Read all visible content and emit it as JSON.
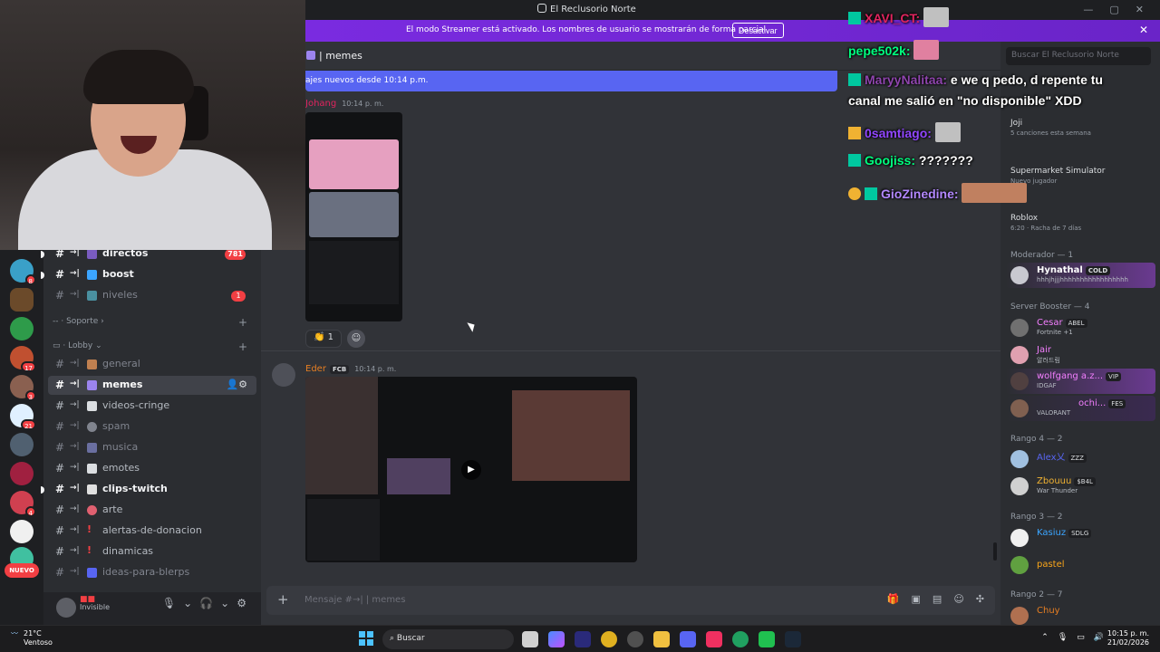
{
  "window": {
    "title": "El Reclusorio Norte",
    "controls": [
      "—",
      "▢",
      "✕"
    ]
  },
  "banner": {
    "text": "El modo Streamer está activado. Los nombres de usuario se mostrarán de forma parcial.",
    "button": "Desactivar"
  },
  "servers": {
    "badges": [
      "8",
      "",
      "",
      "17",
      "3",
      "21",
      "",
      "",
      "4"
    ],
    "new_label": "NUEVO"
  },
  "channels": {
    "items": [
      {
        "name": "directos",
        "arrows": "→|",
        "bold": true,
        "badge": "781"
      },
      {
        "name": "boost",
        "arrows": "→|",
        "bold": true,
        "badge": ""
      },
      {
        "name": "niveles",
        "arrows": "→|",
        "bold": false,
        "badge": "1"
      },
      {
        "name": "general",
        "arrows": "→|",
        "bold": false,
        "badge": ""
      },
      {
        "name": "memes",
        "arrows": "→|",
        "bold": true,
        "badge": ""
      },
      {
        "name": "videos-cringe",
        "arrows": "→|",
        "bold": false,
        "badge": ""
      },
      {
        "name": "spam",
        "arrows": "→|",
        "bold": false,
        "badge": ""
      },
      {
        "name": "musica",
        "arrows": "→|",
        "bold": false,
        "badge": ""
      },
      {
        "name": "emotes",
        "arrows": "→|",
        "bold": false,
        "badge": ""
      },
      {
        "name": "clips-twitch",
        "arrows": "→|",
        "bold": true,
        "badge": ""
      },
      {
        "name": "arte",
        "arrows": "→|",
        "bold": false,
        "badge": ""
      },
      {
        "name": "alertas-de-donacion",
        "arrows": "→|",
        "bold": false,
        "badge": ""
      },
      {
        "name": "dinamicas",
        "arrows": "→|",
        "bold": false,
        "badge": ""
      },
      {
        "name": "ideas-para-blerps",
        "arrows": "→|",
        "bold": false,
        "badge": ""
      }
    ],
    "category_support": "Soporte",
    "category_lobby": "Lobby"
  },
  "user": {
    "status": "Invisible"
  },
  "chat": {
    "channel_name": "memes",
    "new_messages": "ajes nuevos desde 10:14 p.m.",
    "msg1_author": "Johang",
    "msg1_time": "10:14 p. m.",
    "reaction_count": "1",
    "msg2_author": "Eder",
    "msg2_tag": "FCB",
    "msg2_time": "10:14 p. m.",
    "input_placeholder": "Mensaje #→|  | memes"
  },
  "members": {
    "search_placeholder": "Buscar El Reclusorio Norte",
    "activities": [
      {
        "title": "Joji",
        "sub": "5 canciones esta semana"
      },
      {
        "title": "Supermarket Simulator",
        "sub": "Nuevo jugador"
      },
      {
        "title": "Roblox",
        "sub": "6:20 · Racha de 7 días"
      }
    ],
    "group_mod": "Moderador — 1",
    "group_booster": "Server Booster — 4",
    "group_r4": "Rango 4 — 2",
    "group_r3": "Rango 3 — 2",
    "group_r2": "Rango 2 — 7",
    "list": [
      {
        "name": "Hynathal",
        "tag": "COLD",
        "sub": "hhhjhjjjhhhhhhhhhhhhhhhhh",
        "color": "#ffffff"
      },
      {
        "name": "Cesar",
        "tag": "ABEL",
        "sub": "Fortnite +1",
        "color": "#f47fff"
      },
      {
        "name": "Jair",
        "tag": "",
        "sub": "알러드림",
        "color": "#f47fff"
      },
      {
        "name": "wolfgang a.z...",
        "tag": "VIP",
        "sub": "IDGAF",
        "color": "#f47fff"
      },
      {
        "name": "ochi...",
        "tag": "FES",
        "sub": "VALORANT",
        "color": "#f47fff"
      },
      {
        "name": "Alex乂",
        "tag": "ZZZ",
        "sub": "",
        "color": "#5865f2"
      },
      {
        "name": "Zbouuu",
        "tag": "$B4L",
        "sub": "War Thunder",
        "color": "#f0b232"
      },
      {
        "name": "Kasiuz",
        "tag": "SDLG",
        "sub": "",
        "color": "#3ba5ff"
      },
      {
        "name": "pastel",
        "tag": "",
        "sub": "",
        "color": "#faa61a"
      },
      {
        "name": "Chuy",
        "tag": "",
        "sub": "",
        "color": "#e67e22"
      }
    ]
  },
  "twitch_chat": [
    {
      "user": "XAVI_CT:",
      "msg": "",
      "color": "#e0245e"
    },
    {
      "user": "pepe502k:",
      "msg": "",
      "color": "#00ff7f"
    },
    {
      "user": "MaryyNalitaa:",
      "msg": " e we q pedo, d repente tu",
      "color": "#8e44ad"
    },
    {
      "user": "",
      "msg": "canal me salió en \"no disponible\" XDD",
      "color": "#ffffff"
    },
    {
      "user": "0samtiago:",
      "msg": "",
      "color": "#9146ff"
    },
    {
      "user": "Goojiss:",
      "msg": " ???????",
      "color": "#00ff7f"
    },
    {
      "user": "GioZinedine:",
      "msg": "",
      "color": "#b388ff"
    }
  ],
  "taskbar": {
    "temp": "21°C",
    "weather": "Ventoso",
    "search": "Buscar",
    "time": "10:15 p. m.",
    "date": "21/02/2026"
  },
  "colors": {
    "accent": "#5865f2",
    "streamer_banner": "#7a2be0",
    "danger": "#f23f43"
  }
}
